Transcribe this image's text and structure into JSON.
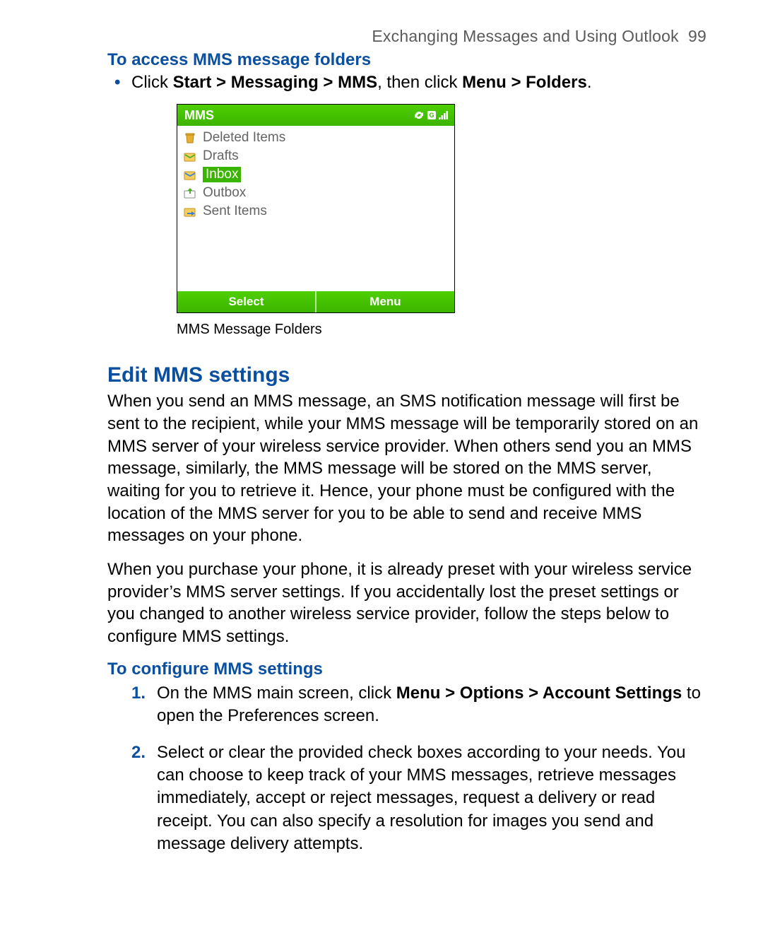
{
  "header": {
    "running": "Exchanging Messages and Using Outlook",
    "page_no": "99"
  },
  "section_access": {
    "title": "To access MMS message folders",
    "bullet_prefix": "Click ",
    "bullet_path1": "Start > Messaging > MMS",
    "bullet_mid": ", then click ",
    "bullet_path2": "Menu > Folders",
    "bullet_suffix": "."
  },
  "screenshot": {
    "title": "MMS",
    "folders": {
      "deleted": "Deleted Items",
      "drafts": "Drafts",
      "inbox": "Inbox",
      "outbox": "Outbox",
      "sent": "Sent Items"
    },
    "softkeys": {
      "left": "Select",
      "right": "Menu"
    },
    "caption": "MMS Message Folders"
  },
  "section_edit": {
    "title": "Edit MMS settings",
    "para1": "When you send an MMS message, an SMS notification message will first be sent to the recipient, while your MMS message will be temporarily stored on an MMS server of your wireless service provider. When others send you an MMS message, similarly, the MMS message will be stored on the MMS server, waiting for you to retrieve it. Hence, your phone must be configured with the location of the MMS server for you to be able to send and receive MMS messages on your phone.",
    "para2": "When you purchase your phone, it is already preset with your wireless service provider’s MMS server settings. If you accidentally lost the preset settings or you changed to another wireless service provider, follow the steps below to configure MMS settings."
  },
  "section_config": {
    "title": "To configure MMS settings",
    "steps": {
      "s1": {
        "num": "1.",
        "pre": "On the MMS main screen, click ",
        "path": "Menu > Options > Account Settings",
        "post": " to open the Preferences screen."
      },
      "s2": {
        "num": "2.",
        "text": "Select or clear the provided check boxes according to your needs. You can choose to keep track of your MMS messages, retrieve messages immediately, accept or reject messages, request a delivery or read receipt. You can also specify a resolution for images you send and message delivery attempts."
      }
    }
  }
}
